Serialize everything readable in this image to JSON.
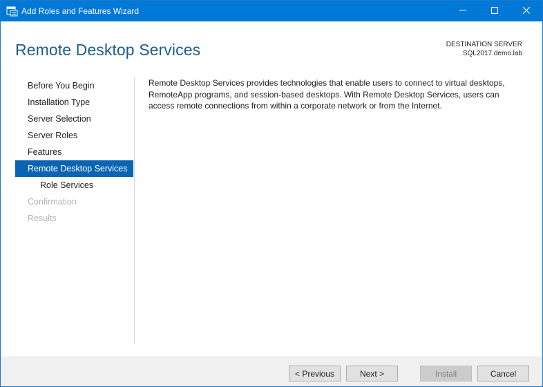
{
  "window": {
    "title": "Add Roles and Features Wizard",
    "accent_color": "#0078d7"
  },
  "header": {
    "page_title": "Remote Desktop Services",
    "destination_label": "DESTINATION SERVER",
    "destination_server": "SQL2017.demo.lab"
  },
  "nav": {
    "items": [
      {
        "label": "Before You Begin",
        "state": "normal"
      },
      {
        "label": "Installation Type",
        "state": "normal"
      },
      {
        "label": "Server Selection",
        "state": "normal"
      },
      {
        "label": "Server Roles",
        "state": "normal"
      },
      {
        "label": "Features",
        "state": "normal"
      },
      {
        "label": "Remote Desktop Services",
        "state": "active"
      },
      {
        "label": "Role Services",
        "state": "sub"
      },
      {
        "label": "Confirmation",
        "state": "disabled"
      },
      {
        "label": "Results",
        "state": "disabled"
      }
    ]
  },
  "content": {
    "description": "Remote Desktop Services provides technologies that enable users to connect to virtual desktops, RemoteApp programs, and session-based desktops. With Remote Desktop Services, users can access remote connections from within a corporate network or from the Internet."
  },
  "footer": {
    "previous_label": "< Previous",
    "next_label": "Next >",
    "install_label": "Install",
    "cancel_label": "Cancel"
  },
  "icons": {
    "app": "server-manager-icon",
    "minimize": "minimize-icon",
    "maximize": "maximize-icon",
    "close": "close-icon"
  }
}
